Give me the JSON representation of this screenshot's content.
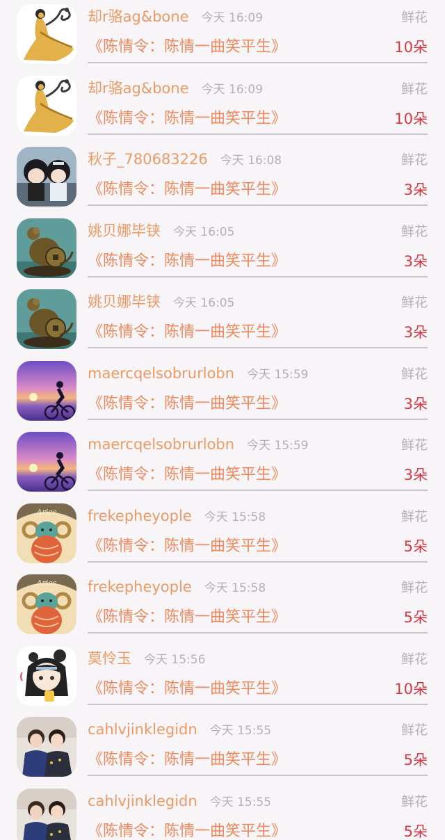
{
  "records": [
    {
      "user": "却r骆ag&bone",
      "time": "今天 16:09",
      "gift_type": "鲜花",
      "work": "《陈情令：陈情一曲笑平生》",
      "count": "10朵",
      "avatar": "golden-dancer-avatar"
    },
    {
      "user": "却r骆ag&bone",
      "time": "今天 16:09",
      "gift_type": "鲜花",
      "work": "《陈情令：陈情一曲笑平生》",
      "count": "10朵",
      "avatar": "golden-dancer-avatar"
    },
    {
      "user": "秋子_780683226",
      "time": "今天 16:08",
      "gift_type": "鲜花",
      "work": "《陈情令：陈情一曲笑平生》",
      "count": "3朵",
      "avatar": "doll-figures-avatar"
    },
    {
      "user": "姚贝娜毕铗",
      "time": "今天 16:05",
      "gift_type": "鲜花",
      "work": "《陈情令：陈情一曲笑平生》",
      "count": "3朵",
      "avatar": "bronze-rat-avatar"
    },
    {
      "user": "姚贝娜毕铗",
      "time": "今天 16:05",
      "gift_type": "鲜花",
      "work": "《陈情令：陈情一曲笑平生》",
      "count": "3朵",
      "avatar": "bronze-rat-avatar"
    },
    {
      "user": "maercqelsobrurlobn",
      "time": "今天 15:59",
      "gift_type": "鲜花",
      "work": "《陈情令：陈情一曲笑平生》",
      "count": "3朵",
      "avatar": "sunset-cyclist-avatar"
    },
    {
      "user": "maercqelsobrurlobn",
      "time": "今天 15:59",
      "gift_type": "鲜花",
      "work": "《陈情令：陈情一曲笑平生》",
      "count": "3朵",
      "avatar": "sunset-cyclist-avatar"
    },
    {
      "user": "frekepheyople",
      "time": "今天 15:58",
      "gift_type": "鲜花",
      "work": "《陈情令：陈情一曲笑平生》",
      "count": "5朵",
      "avatar": "aries-ram-avatar",
      "avatar_text": "Aries"
    },
    {
      "user": "frekepheyople",
      "time": "今天 15:58",
      "gift_type": "鲜花",
      "work": "《陈情令：陈情一曲笑平生》",
      "count": "5朵",
      "avatar": "aries-ram-avatar",
      "avatar_text": "Aries"
    },
    {
      "user": "莫怜玉",
      "time": "今天 15:56",
      "gift_type": "鲜花",
      "work": "《陈情令：陈情一曲笑平生》",
      "count": "10朵",
      "avatar": "anime-girl-avatar"
    },
    {
      "user": "cahlvjinklegidn",
      "time": "今天 15:55",
      "gift_type": "鲜花",
      "work": "《陈情令：陈情一曲笑平生》",
      "count": "5朵",
      "avatar": "two-people-photo-avatar"
    },
    {
      "user": "cahlvjinklegidn",
      "time": "今天 15:55",
      "gift_type": "鲜花",
      "work": "《陈情令：陈情一曲笑平生》",
      "count": "5朵",
      "avatar": "two-people-photo-avatar"
    }
  ]
}
